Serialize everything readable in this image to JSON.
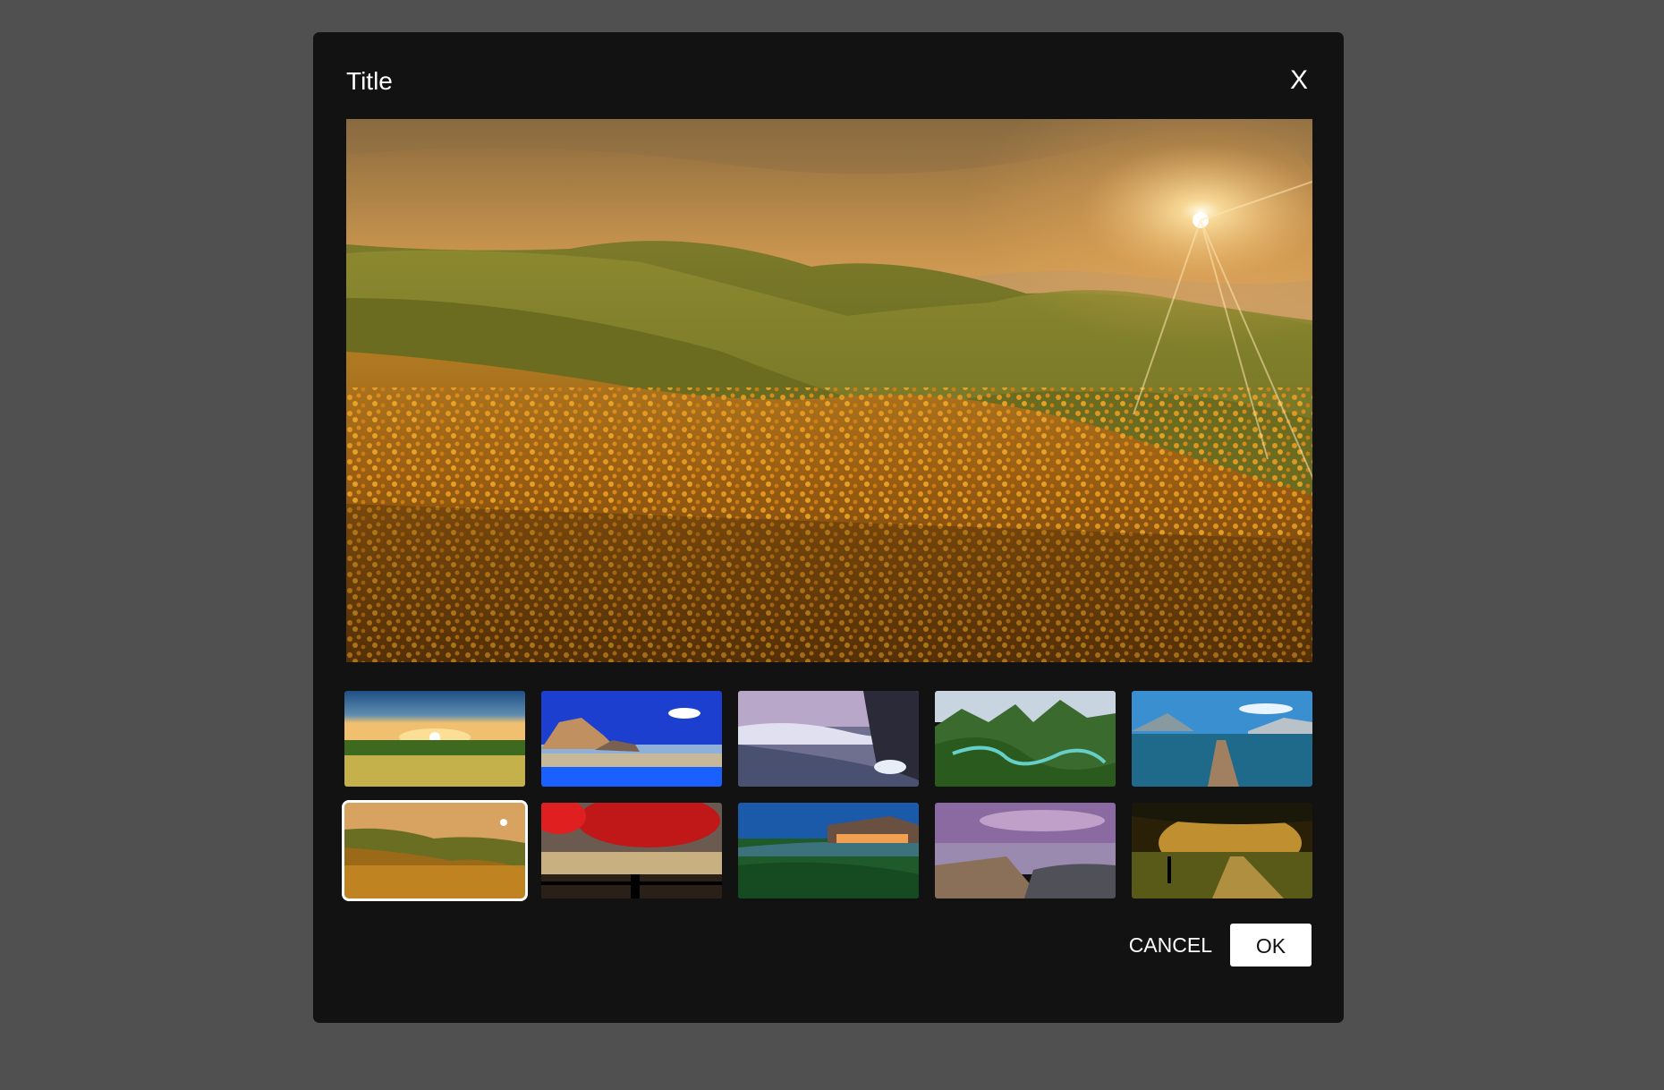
{
  "dialog": {
    "title": "Title",
    "close_label": "X"
  },
  "preview": {
    "image": "golden-hills-flower-field-sunset"
  },
  "thumbnails": [
    {
      "image": "sunrise-over-crop-field",
      "selected": false
    },
    {
      "image": "rocky-beach-blue-sky",
      "selected": false
    },
    {
      "image": "frosty-river-winter",
      "selected": false
    },
    {
      "image": "winding-river-green-valley",
      "selected": false
    },
    {
      "image": "wooden-pier-mountain-lake",
      "selected": false
    },
    {
      "image": "golden-hills-flower-field-sunset",
      "selected": true
    },
    {
      "image": "red-tree-lake-fence",
      "selected": false
    },
    {
      "image": "pagoda-house-on-cliff-night",
      "selected": false
    },
    {
      "image": "rocky-shore-purple-sky",
      "selected": false
    },
    {
      "image": "tree-lined-path-golden-light",
      "selected": false
    }
  ],
  "actions": {
    "cancel_label": "CANCEL",
    "ok_label": "OK"
  },
  "colors": {
    "backdrop": "#505050",
    "dialog_background": "#121212",
    "selection_outline": "#ffffff"
  }
}
